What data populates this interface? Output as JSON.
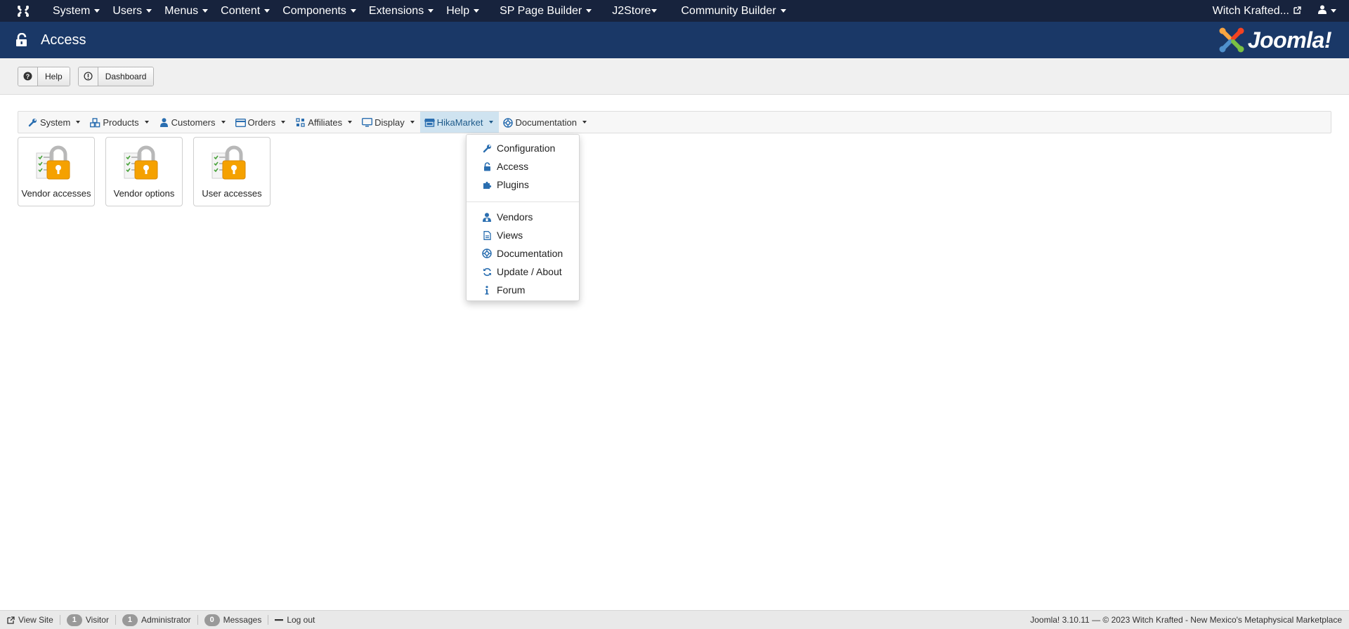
{
  "topnav": {
    "menus": [
      "System",
      "Users",
      "Menus",
      "Content",
      "Components",
      "Extensions",
      "Help",
      "SP Page Builder",
      "J2Store",
      "Community Builder"
    ],
    "site_name": "Witch Krafted..."
  },
  "header": {
    "title": "Access",
    "brand": "Joomla!"
  },
  "toolbar": {
    "help_label": "Help",
    "dashboard_label": "Dashboard"
  },
  "hikabar": {
    "items": [
      {
        "label": "System",
        "icon": "wrench-icon"
      },
      {
        "label": "Products",
        "icon": "cubes-icon"
      },
      {
        "label": "Customers",
        "icon": "user-icon"
      },
      {
        "label": "Orders",
        "icon": "credit-card-icon"
      },
      {
        "label": "Affiliates",
        "icon": "affiliates-icon"
      },
      {
        "label": "Display",
        "icon": "monitor-icon"
      },
      {
        "label": "HikaMarket",
        "icon": "store-icon",
        "active": true
      },
      {
        "label": "Documentation",
        "icon": "lifebuoy-icon"
      }
    ]
  },
  "dropdown": {
    "group1": [
      {
        "label": "Configuration",
        "icon": "wrench-icon"
      },
      {
        "label": "Access",
        "icon": "unlock-icon"
      },
      {
        "label": "Plugins",
        "icon": "puzzle-icon"
      }
    ],
    "group2": [
      {
        "label": "Vendors",
        "icon": "vendor-user-icon"
      },
      {
        "label": "Views",
        "icon": "file-icon"
      },
      {
        "label": "Documentation",
        "icon": "lifebuoy-icon"
      },
      {
        "label": "Update / About",
        "icon": "refresh-icon"
      },
      {
        "label": "Forum",
        "icon": "info-icon"
      }
    ]
  },
  "cards": [
    {
      "label": "Vendor accesses"
    },
    {
      "label": "Vendor options"
    },
    {
      "label": "User accesses"
    }
  ],
  "statusbar": {
    "view_site": "View Site",
    "visitor_count": "1",
    "visitor_label": "Visitor",
    "admin_count": "1",
    "admin_label": "Administrator",
    "messages_count": "0",
    "messages_label": "Messages",
    "logout": "Log out",
    "copyright": "Joomla! 3.10.11  —  © 2023 Witch Krafted - New Mexico's Metaphysical Marketplace"
  },
  "colors": {
    "topnav_bg": "#17233d",
    "header_bg": "#1a3867",
    "accent": "#2a6eb0",
    "active_menu_bg": "#cfe3f0"
  }
}
